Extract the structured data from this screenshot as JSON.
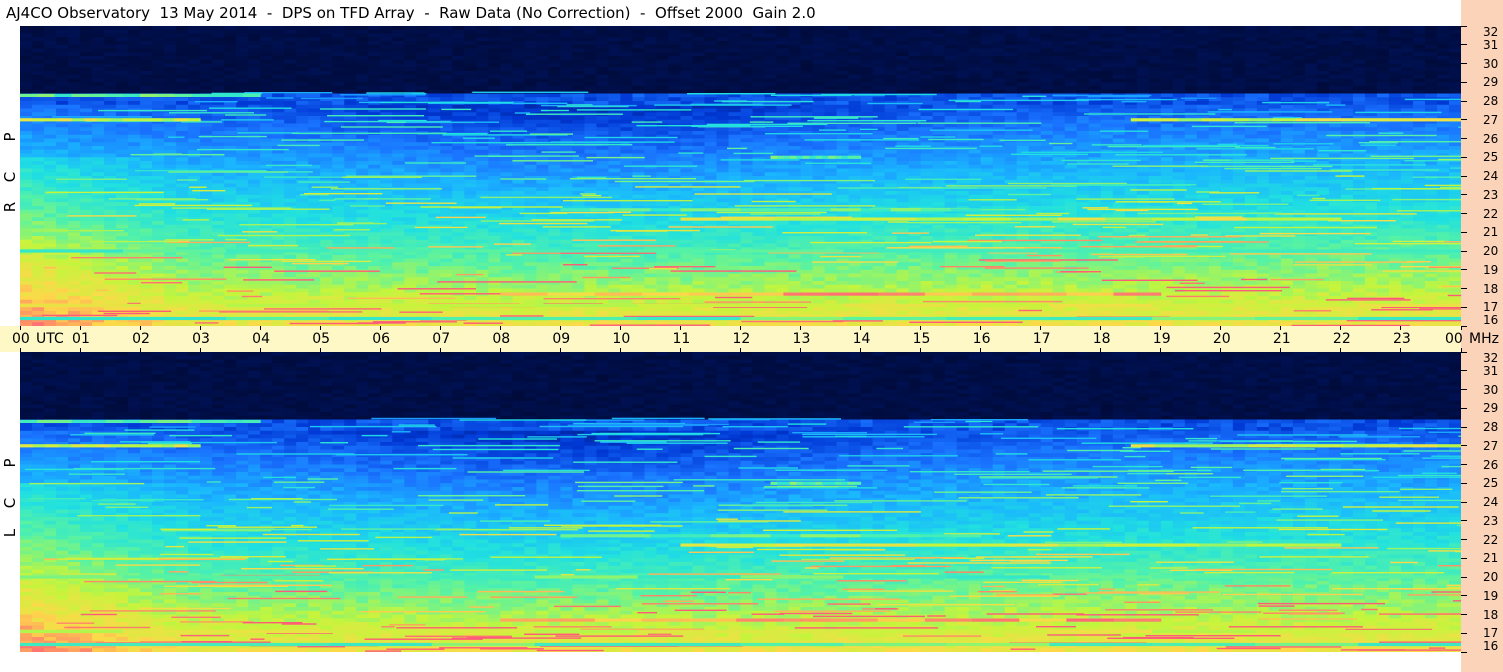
{
  "title": "AJ4CO Observatory  13 May 2014  -  DPS on TFD Array  -  Raw Data (No Correction)  -  Offset 2000  Gain 2.0",
  "colors": {
    "colormap": [
      "#000626",
      "#001a78",
      "#0038d4",
      "#1a73ff",
      "#1ab4ff",
      "#20e0e0",
      "#55f2a6",
      "#c4f53c",
      "#ffd84a",
      "#ff5c7a"
    ],
    "time_axis_bg": "#fdf8c6",
    "freq_axis_bg": "#fbd3b8"
  },
  "chart_data": [
    {
      "type": "heatmap",
      "panel": "RCP",
      "polarization_letters": [
        "R",
        "C",
        "P"
      ],
      "x_ticks": [
        "00",
        "01",
        "02",
        "03",
        "04",
        "05",
        "06",
        "07",
        "08",
        "09",
        "10",
        "11",
        "12",
        "13",
        "14",
        "15",
        "16",
        "17",
        "18",
        "19",
        "20",
        "21",
        "22",
        "23",
        "00"
      ],
      "x_unit": "UTC",
      "y_ticks": [
        32,
        31,
        30,
        29,
        28,
        27,
        26,
        25,
        24,
        23,
        22,
        21,
        20,
        19,
        18,
        17,
        16
      ],
      "y_unit": "MHz",
      "xlim": [
        0,
        24
      ],
      "ylim": [
        16,
        32
      ],
      "features": [
        {
          "type": "band",
          "freq_mhz": 17.7,
          "utc": [
            8,
            19
          ],
          "level": "high"
        },
        {
          "type": "band",
          "freq_mhz": 21.7,
          "utc": [
            11,
            22
          ],
          "level": "medium"
        },
        {
          "type": "band",
          "freq_mhz": 27.0,
          "utc": [
            0,
            3
          ],
          "level": "medium"
        },
        {
          "type": "band",
          "freq_mhz": 27.0,
          "utc": [
            18.5,
            24
          ],
          "level": "medium"
        },
        {
          "type": "band",
          "freq_mhz": 28.3,
          "utc": [
            0,
            4
          ],
          "level": "low"
        },
        {
          "type": "band",
          "freq_mhz": 20.0,
          "utc": [
            0,
            24
          ],
          "level": "low"
        },
        {
          "type": "band",
          "freq_mhz": 17.1,
          "utc": [
            0,
            24
          ],
          "level": "medium"
        },
        {
          "type": "band",
          "freq_mhz": 16.4,
          "utc": [
            0,
            24
          ],
          "level": "low"
        },
        {
          "type": "band",
          "freq_mhz": 22.2,
          "utc": [
            9,
            16
          ],
          "level": "low"
        },
        {
          "type": "band",
          "freq_mhz": 25.0,
          "utc": [
            12.5,
            14
          ],
          "level": "low"
        }
      ]
    },
    {
      "type": "heatmap",
      "panel": "LCP",
      "polarization_letters": [
        "L",
        "C",
        "P"
      ],
      "y_ticks": [
        32,
        31,
        30,
        29,
        28,
        27,
        26,
        25,
        24,
        23,
        22,
        21,
        20,
        19,
        18,
        17,
        16
      ],
      "y_unit": "MHz",
      "xlim": [
        0,
        24
      ],
      "ylim": [
        16,
        32
      ],
      "features": [
        {
          "type": "band",
          "freq_mhz": 17.7,
          "utc": [
            8,
            19
          ],
          "level": "high"
        },
        {
          "type": "band",
          "freq_mhz": 21.7,
          "utc": [
            11,
            22
          ],
          "level": "medium"
        },
        {
          "type": "band",
          "freq_mhz": 27.0,
          "utc": [
            0,
            3
          ],
          "level": "medium"
        },
        {
          "type": "band",
          "freq_mhz": 27.0,
          "utc": [
            18.5,
            24
          ],
          "level": "medium"
        },
        {
          "type": "band",
          "freq_mhz": 28.3,
          "utc": [
            0,
            4
          ],
          "level": "low"
        },
        {
          "type": "band",
          "freq_mhz": 20.0,
          "utc": [
            0,
            24
          ],
          "level": "low"
        },
        {
          "type": "band",
          "freq_mhz": 17.1,
          "utc": [
            0,
            24
          ],
          "level": "medium"
        },
        {
          "type": "band",
          "freq_mhz": 16.4,
          "utc": [
            0,
            24
          ],
          "level": "low"
        },
        {
          "type": "band",
          "freq_mhz": 22.2,
          "utc": [
            9,
            16
          ],
          "level": "low"
        },
        {
          "type": "band",
          "freq_mhz": 25.0,
          "utc": [
            12.5,
            14
          ],
          "level": "low"
        }
      ]
    }
  ]
}
